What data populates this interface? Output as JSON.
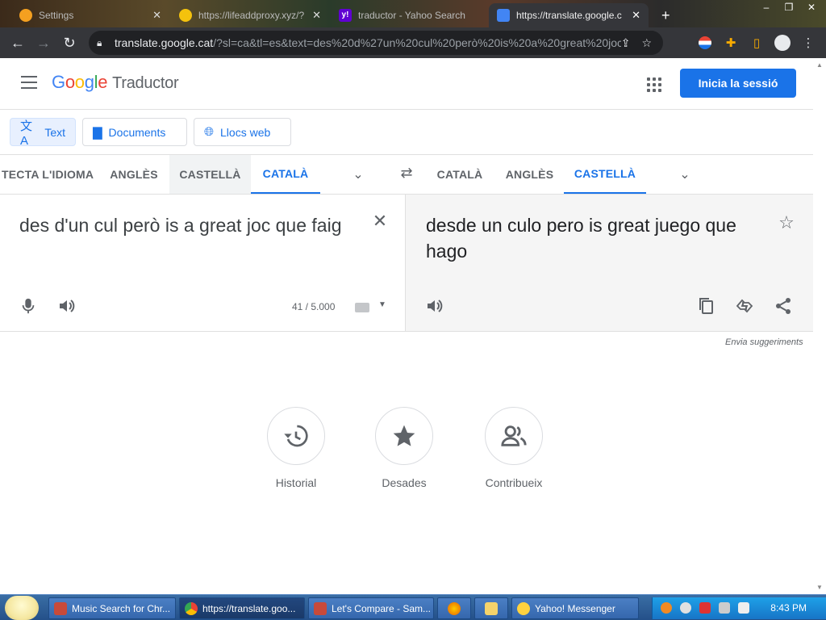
{
  "browser": {
    "tabs": [
      {
        "title": "Settings",
        "favicon_color": "#f4a020"
      },
      {
        "title": "https://lifeaddproxy.xyz/?",
        "favicon_color": "#f4c20d"
      },
      {
        "title": "traductor - Yahoo Search",
        "favicon_color": "#6001d2"
      },
      {
        "title": "https://translate.google.c",
        "favicon_color": "#4285f4"
      }
    ],
    "new_tab_label": "+",
    "url_host": "translate.google.cat",
    "url_path": "/?sl=ca&tl=es&text=des%20d%27un%20cul%20però%20is%20a%20great%20joc..."
  },
  "header": {
    "logo_letters": [
      "G",
      "o",
      "o",
      "g",
      "l",
      "e"
    ],
    "product": "Traductor",
    "signin_label": "Inicia la sessió"
  },
  "modes": [
    {
      "label": "Text",
      "icon": "translate-icon"
    },
    {
      "label": "Documents",
      "icon": "document-icon"
    },
    {
      "label": "Llocs web",
      "icon": "globe-icon"
    }
  ],
  "source_languages": [
    "TECTA L'IDIOMA",
    "ANGLÈS",
    "CASTELLÀ",
    "CATALÀ"
  ],
  "target_languages": [
    "CATALÀ",
    "ANGLÈS",
    "CASTELLÀ"
  ],
  "source": {
    "text": "des d'un cul però is a great joc que faig",
    "counter": "41 / 5.000"
  },
  "target": {
    "text": "desde un culo pero is great juego que hago"
  },
  "feedback_label": "Envia suggeriments",
  "shortcuts": [
    {
      "label": "Historial",
      "icon": "history-icon"
    },
    {
      "label": "Desades",
      "icon": "star-icon"
    },
    {
      "label": "Contribueix",
      "icon": "people-icon"
    }
  ],
  "taskbar": {
    "items": [
      "Music Search for Chr...",
      "https://translate.goo...",
      "Let's Compare - Sam...",
      "Yahoo! Messenger"
    ],
    "clock": "8:43 PM"
  }
}
